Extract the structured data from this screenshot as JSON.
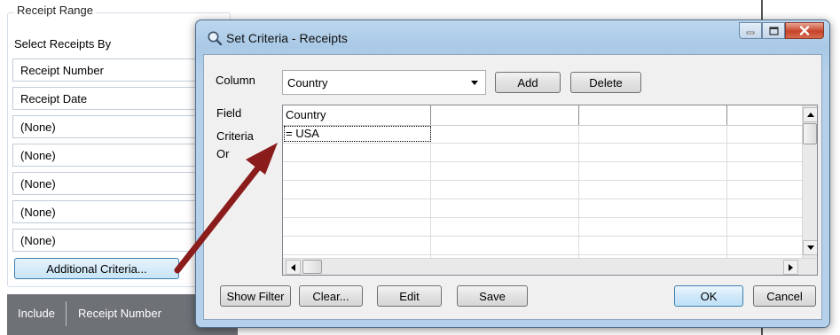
{
  "background": {
    "group_title": "Receipt Range",
    "select_by_label": "Select Receipts By",
    "rows": [
      "Receipt Number",
      "Receipt Date",
      "(None)",
      "(None)",
      "(None)",
      "(None)",
      "(None)"
    ],
    "additional_criteria_label": "Additional Criteria...",
    "table_headers": [
      "Include",
      "Receipt Number"
    ]
  },
  "dialog": {
    "title": "Set Criteria - Receipts",
    "title_icon": "search-icon",
    "column_label": "Column",
    "column_value": "Country",
    "add_label": "Add",
    "delete_label": "Delete",
    "row_labels": {
      "field": "Field",
      "criteria": "Criteria",
      "or": "Or"
    },
    "grid": {
      "header": [
        "Country",
        "",
        "",
        ""
      ],
      "criteria_row": [
        "= USA",
        "",
        "",
        ""
      ]
    },
    "buttons": {
      "show_filter": "Show Filter",
      "clear": "Clear...",
      "edit": "Edit",
      "save": "Save",
      "ok": "OK",
      "cancel": "Cancel"
    }
  },
  "colors": {
    "annotation_arrow": "#8b1c1c",
    "dialog_frame": "#b4d0ea",
    "default_button_border": "#3c7fb1"
  }
}
